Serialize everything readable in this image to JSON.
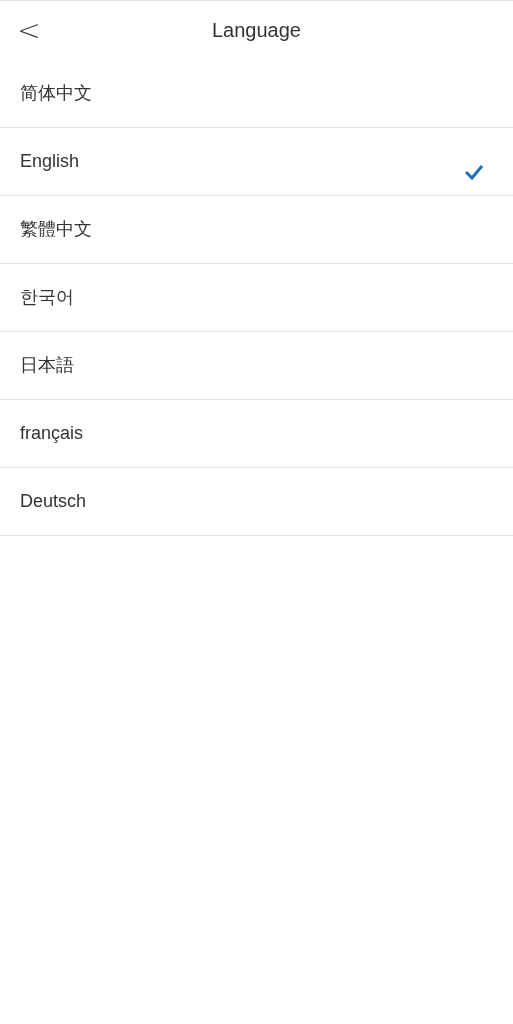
{
  "header": {
    "back": "<",
    "title": "Language"
  },
  "languages": [
    {
      "label": "简体中文",
      "selected": false
    },
    {
      "label": "English",
      "selected": true
    },
    {
      "label": "繁體中文",
      "selected": false
    },
    {
      "label": "한국어",
      "selected": false
    },
    {
      "label": "日本語",
      "selected": false
    },
    {
      "label": "français",
      "selected": false
    },
    {
      "label": "Deutsch",
      "selected": false
    }
  ]
}
